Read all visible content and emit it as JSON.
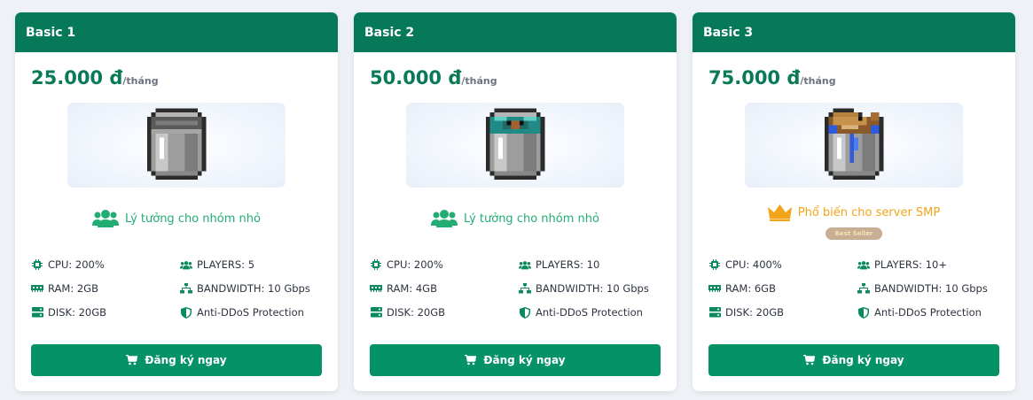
{
  "colors": {
    "header": "#067a58",
    "price": "#087a58",
    "button": "#059266",
    "tagline_green": "#22ad74",
    "tagline_gold": "#f3a419",
    "spec_icon": "#0b8a5e",
    "page_bg": "#eef1f6"
  },
  "plans": [
    {
      "name": "Basic 1",
      "price": "25.000 đ",
      "period": "/tháng",
      "image_icon": "empty-bucket",
      "tagline": "Lý tưởng cho nhóm nhỏ",
      "tagline_icon": "users-icon",
      "specs": {
        "cpu": "CPU: 200%",
        "ram": "RAM: 2GB",
        "disk": "DISK: 20GB",
        "players": "PLAYERS: 5",
        "bandwidth": "BANDWIDTH: 10 Gbps",
        "ddos": "Anti-DDoS Protection"
      },
      "button": "Đăng ký ngay"
    },
    {
      "name": "Basic 2",
      "price": "50.000 đ",
      "period": "/tháng",
      "image_icon": "bucket-of-axolotl",
      "tagline": "Lý tưởng cho nhóm nhỏ",
      "tagline_icon": "users-icon",
      "specs": {
        "cpu": "CPU: 200%",
        "ram": "RAM: 4GB",
        "disk": "DISK: 20GB",
        "players": "PLAYERS: 10",
        "bandwidth": "BANDWIDTH: 10 Gbps",
        "ddos": "Anti-DDoS Protection"
      },
      "button": "Đăng ký ngay"
    },
    {
      "name": "Basic 3",
      "price": "75.000 đ",
      "period": "/tháng",
      "image_icon": "bucket-of-fish",
      "tagline": "Phổ biến cho server SMP",
      "tagline_icon": "crown-icon",
      "badge": "Best Seller",
      "specs": {
        "cpu": "CPU: 400%",
        "ram": "RAM: 6GB",
        "disk": "DISK: 20GB",
        "players": "PLAYERS: 10+",
        "bandwidth": "BANDWIDTH: 10 Gbps",
        "ddos": "Anti-DDoS Protection"
      },
      "button": "Đăng ký ngay"
    }
  ]
}
